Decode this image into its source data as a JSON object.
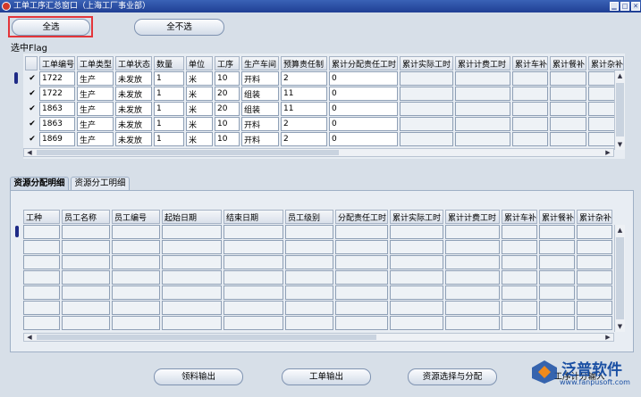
{
  "window": {
    "title": "工单工序汇总窗口（上海工厂事业部）"
  },
  "toolbar": {
    "select_all": "全选",
    "deselect_all": "全不选"
  },
  "top_grid": {
    "flag_label": "选中Flag",
    "headers": [
      "工单编号",
      "工单类型",
      "工单状态",
      "数量",
      "单位",
      "工序",
      "生产车间",
      "预算责任制",
      "累计分配责任工时",
      "累计实际工时",
      "累计计费工时",
      "累计车补",
      "累计餐补",
      "累计杂补"
    ],
    "rows": [
      {
        "check": "✔",
        "cells": [
          "1722",
          "生产",
          "未发放",
          "1",
          "米",
          "10",
          "开料",
          "2",
          "0"
        ]
      },
      {
        "check": "✔",
        "cells": [
          "1722",
          "生产",
          "未发放",
          "1",
          "米",
          "20",
          "组装",
          "11",
          "0"
        ]
      },
      {
        "check": "✔",
        "cells": [
          "1863",
          "生产",
          "未发放",
          "1",
          "米",
          "20",
          "组装",
          "11",
          "0"
        ]
      },
      {
        "check": "✔",
        "cells": [
          "1863",
          "生产",
          "未发放",
          "1",
          "米",
          "10",
          "开料",
          "2",
          "0"
        ]
      },
      {
        "check": "✔",
        "cells": [
          "1869",
          "生产",
          "未发放",
          "1",
          "米",
          "10",
          "开料",
          "2",
          "0"
        ]
      }
    ]
  },
  "tabs": [
    {
      "label": "资源分配明细"
    },
    {
      "label": "资源分工明细"
    }
  ],
  "bottom_grid": {
    "headers": [
      "工种",
      "员工名称",
      "员工编号",
      "起始日期",
      "结束日期",
      "员工级别",
      "分配责任工时",
      "累计实际工时",
      "累计计费工时",
      "累计车补",
      "累计餐补",
      "累计杂补"
    ]
  },
  "buttons": {
    "material_out": "领料输出",
    "order_out": "工单输出",
    "resource_select": "资源选择与分配",
    "partial_output": "工序计分输入"
  },
  "logo": {
    "brand": "泛普软件",
    "url": "www.fanpusoft.com"
  },
  "colors": {
    "highlight": "#e3353a",
    "title_bar": "#1f3f94",
    "brand": "#1a4fa3",
    "selection": "#1e2a86"
  }
}
